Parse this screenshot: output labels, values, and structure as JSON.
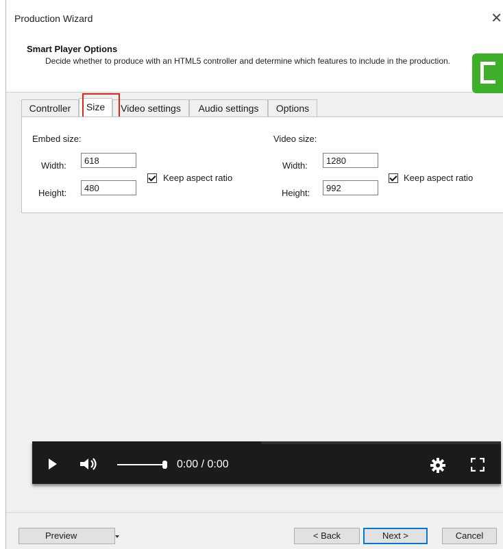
{
  "window": {
    "title": "Production Wizard",
    "close_glyph": "✕"
  },
  "header": {
    "title": "Smart Player Options",
    "description": "Decide whether to produce with an HTML5 controller and determine which features to include in the production.",
    "logo_icon": "camtasia-logo-icon",
    "logo_color": "#3fae29"
  },
  "tabs": [
    {
      "label": "Controller",
      "active": false
    },
    {
      "label": "Size",
      "active": true
    },
    {
      "label": "Video settings",
      "active": false
    },
    {
      "label": "Audio settings",
      "active": false
    },
    {
      "label": "Options",
      "active": false
    }
  ],
  "highlight_color": "#e2231a",
  "embed": {
    "section_label": "Embed size:",
    "width_label": "Width:",
    "width_value": "618",
    "height_label": "Height:",
    "height_value": "480",
    "keep_aspect_label": "Keep aspect ratio",
    "keep_aspect_checked": true
  },
  "video": {
    "section_label": "Video size:",
    "width_label": "Width:",
    "width_value": "1280",
    "height_label": "Height:",
    "height_value": "992",
    "keep_aspect_label": "Keep aspect ratio",
    "keep_aspect_checked": true
  },
  "player": {
    "time": "0:00 / 0:00",
    "icons": [
      "play-icon",
      "volume-icon",
      "gear-icon",
      "fullscreen-icon"
    ]
  },
  "footer": {
    "preview_label": "Preview",
    "back_label": "< Back",
    "next_label": "Next >",
    "cancel_label": "Cancel"
  }
}
